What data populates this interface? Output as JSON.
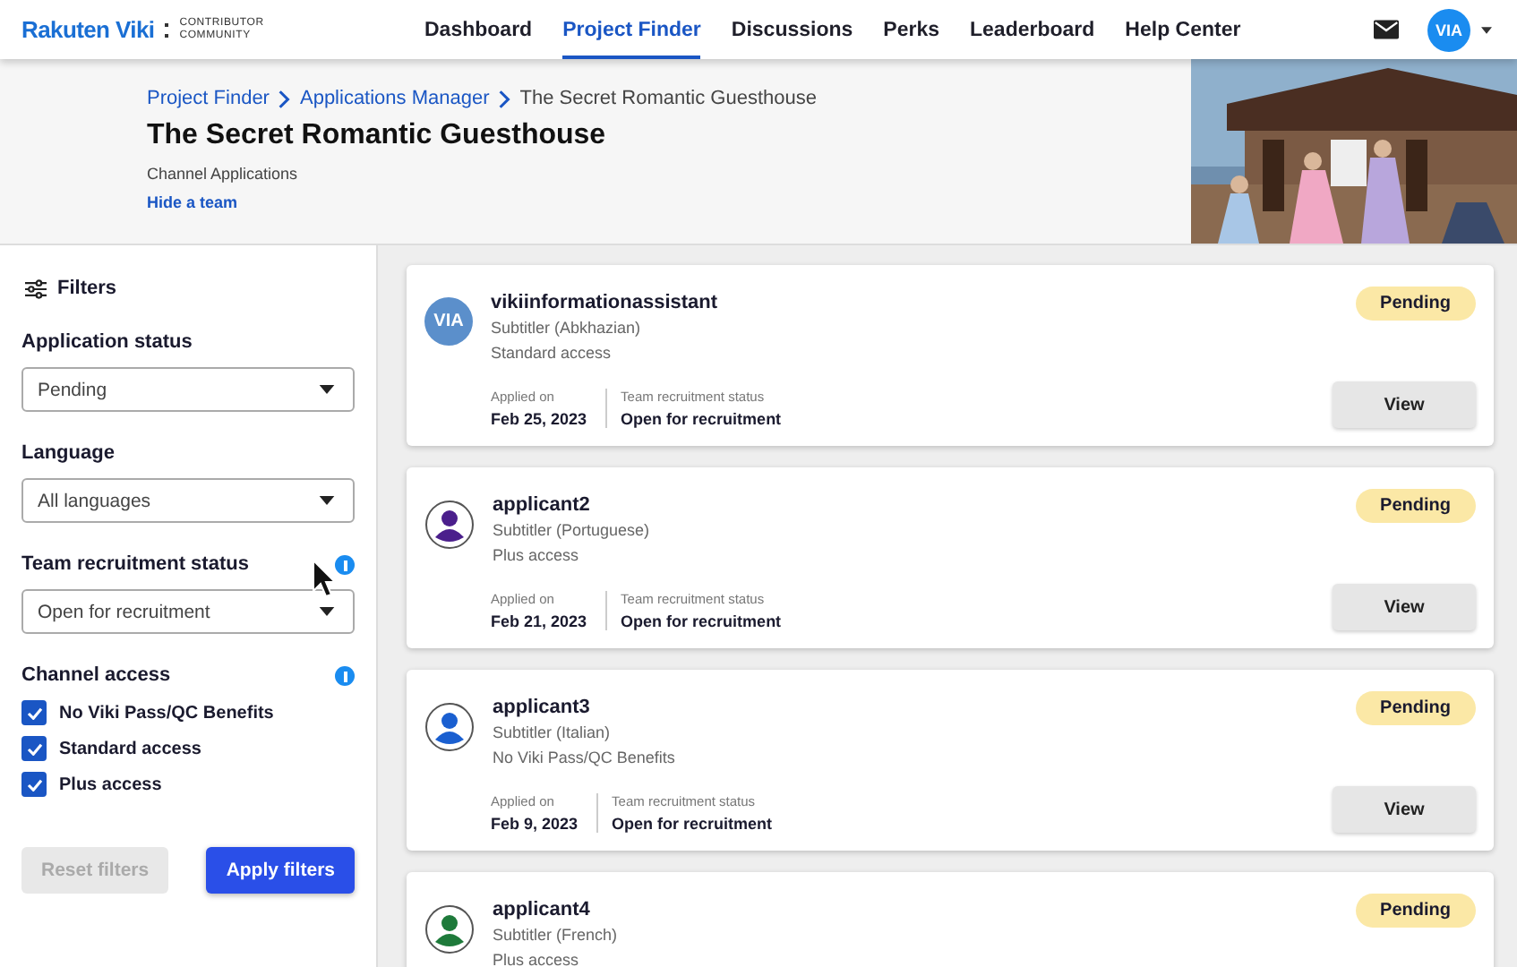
{
  "header": {
    "logo": "Rakuten Viki",
    "logo_sub": "CONTRIBUTOR COMMUNITY",
    "nav": [
      {
        "label": "Dashboard",
        "selected": false
      },
      {
        "label": "Project Finder",
        "selected": true
      },
      {
        "label": "Discussions",
        "selected": false
      },
      {
        "label": "Perks",
        "selected": false
      },
      {
        "label": "Leaderboard",
        "selected": false
      },
      {
        "label": "Help Center",
        "selected": false
      }
    ],
    "avatar": "VIA"
  },
  "hero": {
    "breadcrumbs": [
      "Project Finder",
      "Applications Manager",
      "The Secret Romantic Guesthouse"
    ],
    "title": "The Secret Romantic Guesthouse",
    "subtitle": "Channel Applications",
    "link": "Hide a team",
    "image": {
      "kind": "picture"
    }
  },
  "filters": {
    "title": "Filters",
    "selects": [
      {
        "label": "Application status",
        "value": "Pending",
        "info": false
      },
      {
        "label": "Language",
        "value": "All languages",
        "info": false
      },
      {
        "label": "Team recruitment status",
        "value": "Open for recruitment",
        "info": true
      }
    ],
    "access": {
      "label": "Channel access",
      "info": true,
      "options": [
        {
          "label": "No Viki Pass/QC Benefits",
          "checked": true
        },
        {
          "label": "Standard access",
          "checked": true
        },
        {
          "label": "Plus access",
          "checked": true
        }
      ]
    },
    "buttons": [
      {
        "label": "Reset filters",
        "disabled": true,
        "primary": false
      },
      {
        "label": "Apply filters",
        "disabled": false,
        "primary": true
      }
    ]
  },
  "applications": [
    {
      "avatar": {
        "kind": "initials",
        "text": "VIA",
        "color": "#5b8fcb"
      },
      "name": "vikiinformationassistant",
      "role": "Subtitler (Abkhazian)",
      "access": "Standard access",
      "status": "Pending",
      "applied_label": "Applied on",
      "applied": "Feb 25, 2023",
      "team_label": "Team recruitment status",
      "team": "Open for recruitment",
      "action": "View"
    },
    {
      "avatar": {
        "kind": "person",
        "color": "#4b1f8c"
      },
      "name": "applicant2",
      "role": "Subtitler (Portuguese)",
      "access": "Plus access",
      "status": "Pending",
      "applied_label": "Applied on",
      "applied": "Feb 21, 2023",
      "team_label": "Team recruitment status",
      "team": "Open for recruitment",
      "action": "View"
    },
    {
      "avatar": {
        "kind": "person",
        "color": "#1a5fd0"
      },
      "name": "applicant3",
      "role": "Subtitler (Italian)",
      "access": "No Viki Pass/QC Benefits",
      "status": "Pending",
      "applied_label": "Applied on",
      "applied": "Feb 9, 2023",
      "team_label": "Team recruitment status",
      "team": "Open for recruitment",
      "action": "View"
    },
    {
      "avatar": {
        "kind": "person",
        "color": "#1e7a3a"
      },
      "name": "applicant4",
      "role": "Subtitler (French)",
      "access": "Plus access",
      "status": "Pending"
    }
  ]
}
